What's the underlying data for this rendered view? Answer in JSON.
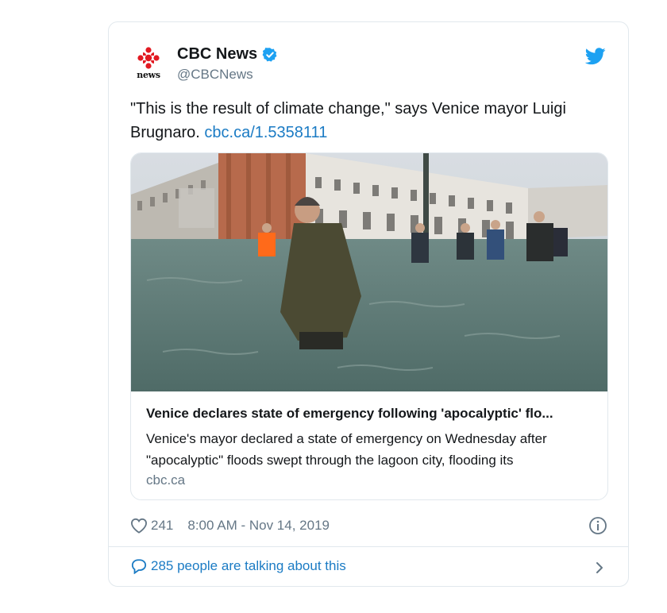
{
  "tweet": {
    "author": {
      "display_name": "CBC News",
      "handle": "@CBCNews",
      "logo_text": "news",
      "verified_icon": "verified-badge-icon",
      "brand_color": "#e21a22"
    },
    "text_part1": "\"This is the result of climate change,\" says Venice mayor Luigi Brugnaro. ",
    "link": "cbc.ca/1.5358111",
    "card": {
      "title": "Venice declares state of emergency following 'apocalyptic' flo...",
      "description": "Venice's mayor declared a state of emergency on Wednesday after \"apocalyptic\" floods swept through the lagoon city, flooding its",
      "domain": "cbc.ca"
    },
    "likes": "241",
    "timestamp": "8:00 AM - Nov 14, 2019",
    "talking": "285 people are talking about this",
    "colors": {
      "link": "#1b7bc4",
      "muted": "#657786",
      "twitter_blue": "#1da1f2"
    }
  }
}
